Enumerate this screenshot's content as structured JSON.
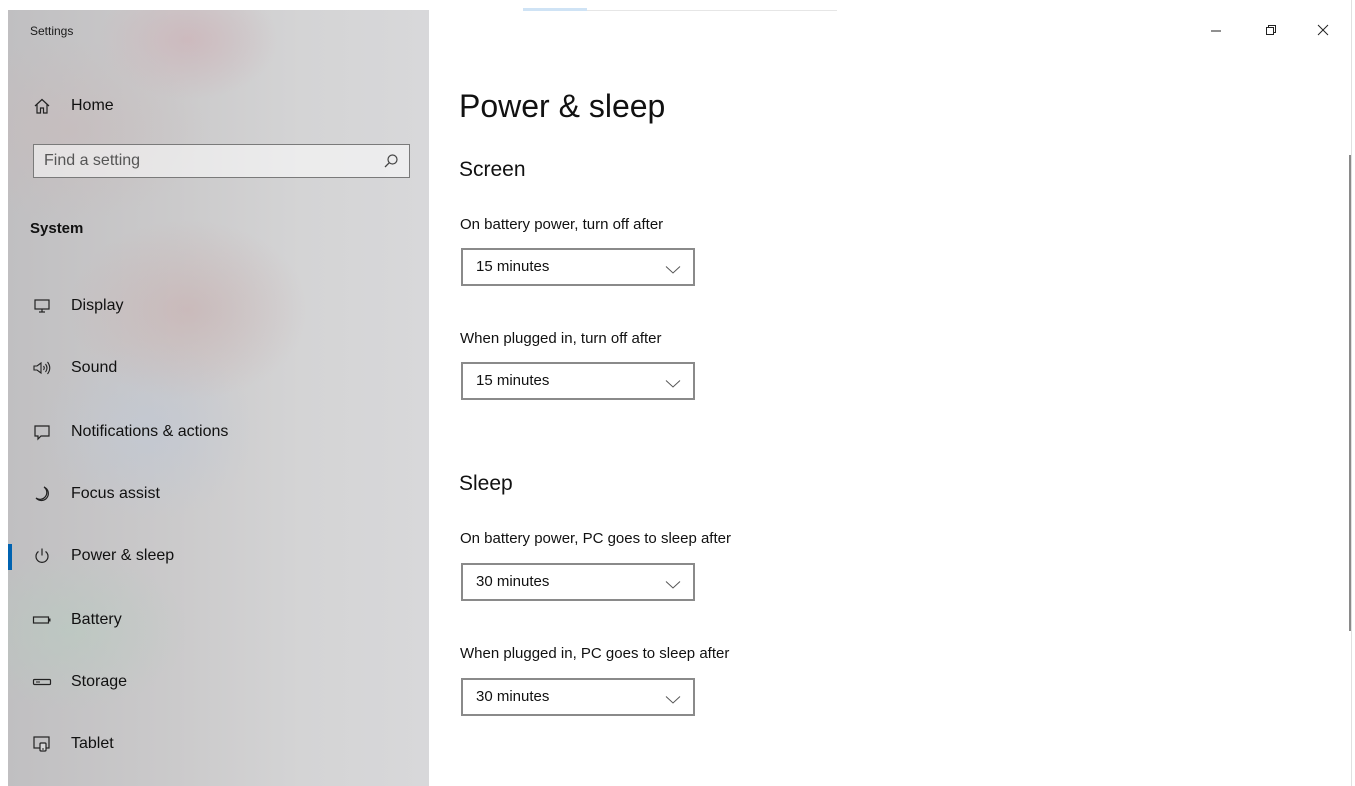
{
  "window": {
    "title": "Settings",
    "controls": {
      "minimize": "minimize",
      "maximize": "maximize",
      "close": "close"
    }
  },
  "sidebar": {
    "home_label": "Home",
    "search": {
      "placeholder": "Find a setting"
    },
    "section_label": "System",
    "items": [
      {
        "label": "Display",
        "icon": "monitor-icon"
      },
      {
        "label": "Sound",
        "icon": "speaker-icon"
      },
      {
        "label": "Notifications & actions",
        "icon": "notification-icon"
      },
      {
        "label": "Focus assist",
        "icon": "moon-icon"
      },
      {
        "label": "Power & sleep",
        "icon": "power-icon",
        "active": true
      },
      {
        "label": "Battery",
        "icon": "battery-icon"
      },
      {
        "label": "Storage",
        "icon": "storage-icon"
      },
      {
        "label": "Tablet",
        "icon": "tablet-icon"
      }
    ]
  },
  "main": {
    "title": "Power & sleep",
    "screen": {
      "heading": "Screen",
      "battery_label": "On battery power, turn off after",
      "battery_value": "15 minutes",
      "plugged_label": "When plugged in, turn off after",
      "plugged_value": "15 minutes"
    },
    "sleep": {
      "heading": "Sleep",
      "battery_label": "On battery power, PC goes to sleep after",
      "battery_value": "30 minutes",
      "plugged_label": "When plugged in, PC goes to sleep after",
      "plugged_value": "30 minutes"
    }
  },
  "colors": {
    "accent": "#0063b1"
  }
}
